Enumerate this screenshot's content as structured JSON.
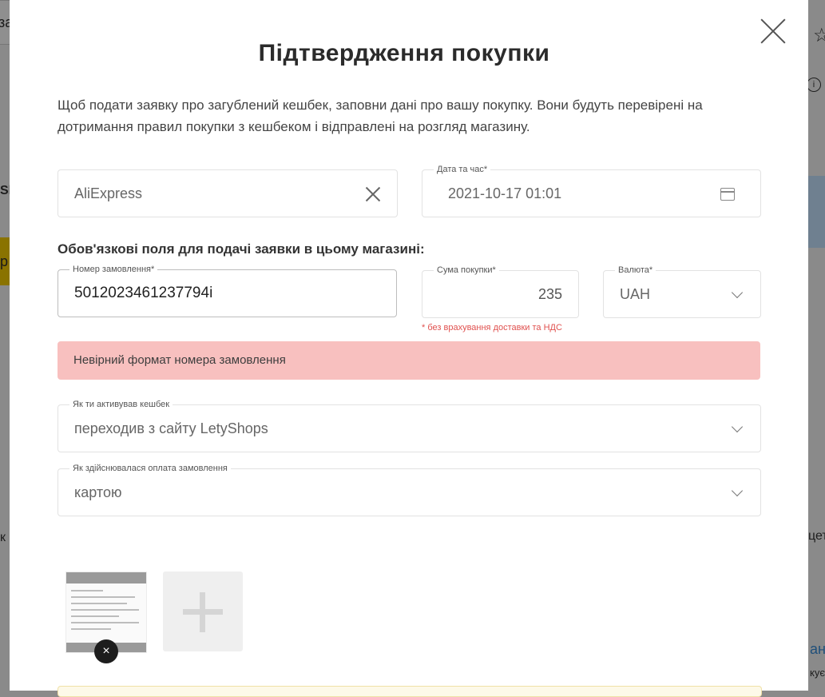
{
  "background": {
    "search_fragment": "за",
    "brand_fragment": "Sh",
    "button_fragment": "р",
    "left_fragment": "к",
    "right_fragment_1": "цет",
    "right_fragment_2": "ан",
    "right_fragment_3": "кує"
  },
  "modal": {
    "title": "Підтвердження покупки",
    "intro": "Щоб подати заявку про загублений кешбек, заповни дані про вашу покупку. Вони будуть перевірені на дотримання правил покупки з кешбеком і відправлені на розгляд магазину.",
    "store": {
      "value": "AliExpress"
    },
    "datetime": {
      "label": "Дата та час*",
      "value": "2021-10-17 01:01"
    },
    "section_title": "Обов'язкові поля для подачі заявки в цьому магазині:",
    "order_number": {
      "label": "Номер замовлення*",
      "value": "5012023461237794i"
    },
    "amount": {
      "label": "Сума покупки*",
      "value": "235"
    },
    "currency": {
      "label": "Валюта*",
      "value": "UAH"
    },
    "amount_note": "* без врахування доставки та НДС",
    "error": "Невірний формат номера замовлення",
    "activation": {
      "label": "Як ти активував кешбек",
      "value": "переходив з сайту LetyShops"
    },
    "payment": {
      "label": "Як здійснювалася оплата замовлення",
      "value": "картою"
    },
    "remove_icon": "×"
  },
  "colors": {
    "error_bg": "#f8c0bf",
    "note_red": "#e0514f",
    "overlay": "#8a8a8a"
  }
}
